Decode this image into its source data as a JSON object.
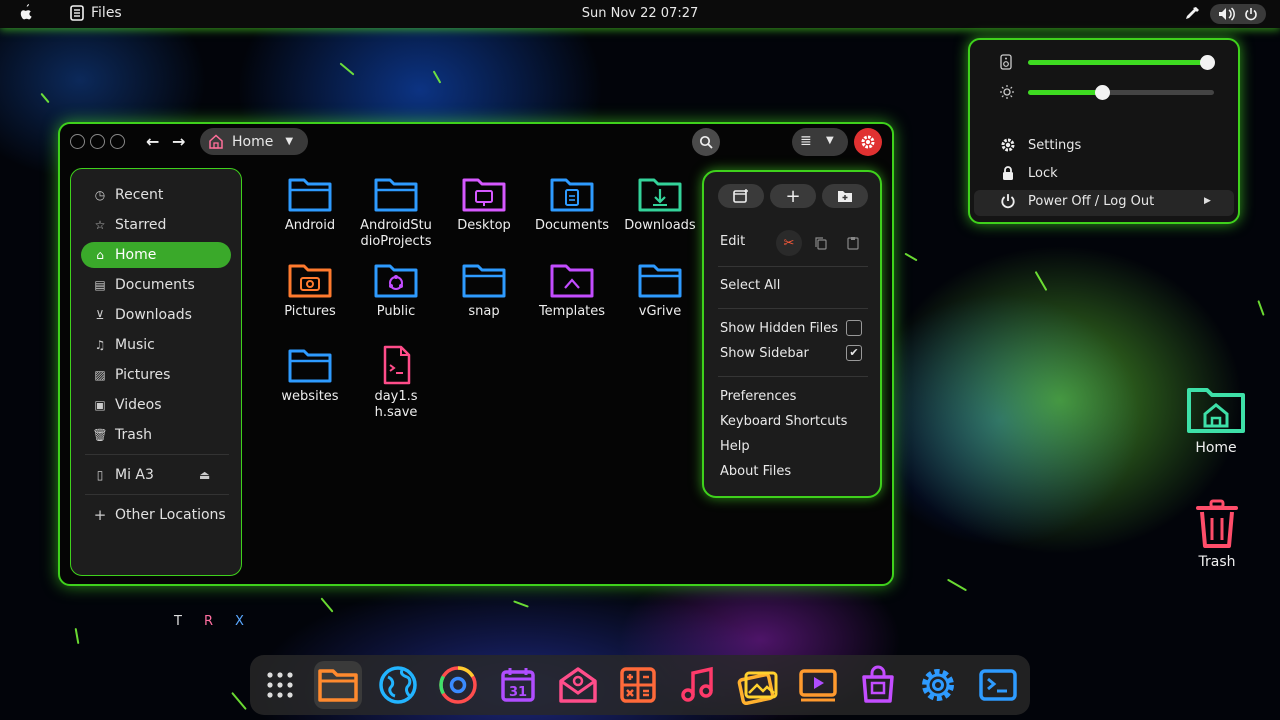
{
  "topbar": {
    "app_name": "Files",
    "clock": "Sun Nov 22  07:27"
  },
  "quick_settings": {
    "volume_level": 0.96,
    "brightness_level": 0.4,
    "settings_label": "Settings",
    "lock_label": "Lock",
    "power_label": "Power Off / Log Out"
  },
  "window": {
    "path_label": "Home"
  },
  "sidebar": {
    "items": [
      {
        "label": "Recent",
        "icon": "clock-icon"
      },
      {
        "label": "Starred",
        "icon": "star-icon"
      },
      {
        "label": "Home",
        "icon": "home-icon"
      },
      {
        "label": "Documents",
        "icon": "document-icon"
      },
      {
        "label": "Downloads",
        "icon": "download-icon"
      },
      {
        "label": "Music",
        "icon": "music-icon"
      },
      {
        "label": "Pictures",
        "icon": "picture-icon"
      },
      {
        "label": "Videos",
        "icon": "video-icon"
      },
      {
        "label": "Trash",
        "icon": "trash-icon"
      }
    ],
    "device_label": "Mi A3",
    "other_locations_label": "Other Locations"
  },
  "files": [
    {
      "label": "Android",
      "color": "#2e9bff"
    },
    {
      "label": "AndroidStudioProjects",
      "color": "#2e9bff"
    },
    {
      "label": "Desktop",
      "color": "#d659ff"
    },
    {
      "label": "Documents",
      "color": "#2e9bff"
    },
    {
      "label": "Downloads",
      "color": "#34d39a"
    },
    {
      "label": "Pictures",
      "color": "#ff7a2e"
    },
    {
      "label": "Public",
      "color": "#2e9bff"
    },
    {
      "label": "snap",
      "color": "#2e9bff"
    },
    {
      "label": "Templates",
      "color": "#c34dff"
    },
    {
      "label": "vGrive",
      "color": "#2e9bff"
    },
    {
      "label": "websites",
      "color": "#2e9bff"
    },
    {
      "label": "day1.sh.save",
      "color": "#ff4d8a"
    }
  ],
  "menu": {
    "edit_label": "Edit",
    "select_all_label": "Select All",
    "show_hidden_label": "Show Hidden Files",
    "show_hidden_checked": false,
    "show_sidebar_label": "Show Sidebar",
    "show_sidebar_checked": true,
    "check_mark": "✔",
    "preferences_label": "Preferences",
    "shortcuts_label": "Keyboard Shortcuts",
    "help_label": "Help",
    "about_label": "About Files"
  },
  "desktop": {
    "home_label": "Home",
    "trash_label": "Trash",
    "tray_letters": [
      "T",
      "R",
      "X"
    ]
  },
  "colors": {
    "accent": "#3fd11c",
    "active": "#3aa92a"
  }
}
